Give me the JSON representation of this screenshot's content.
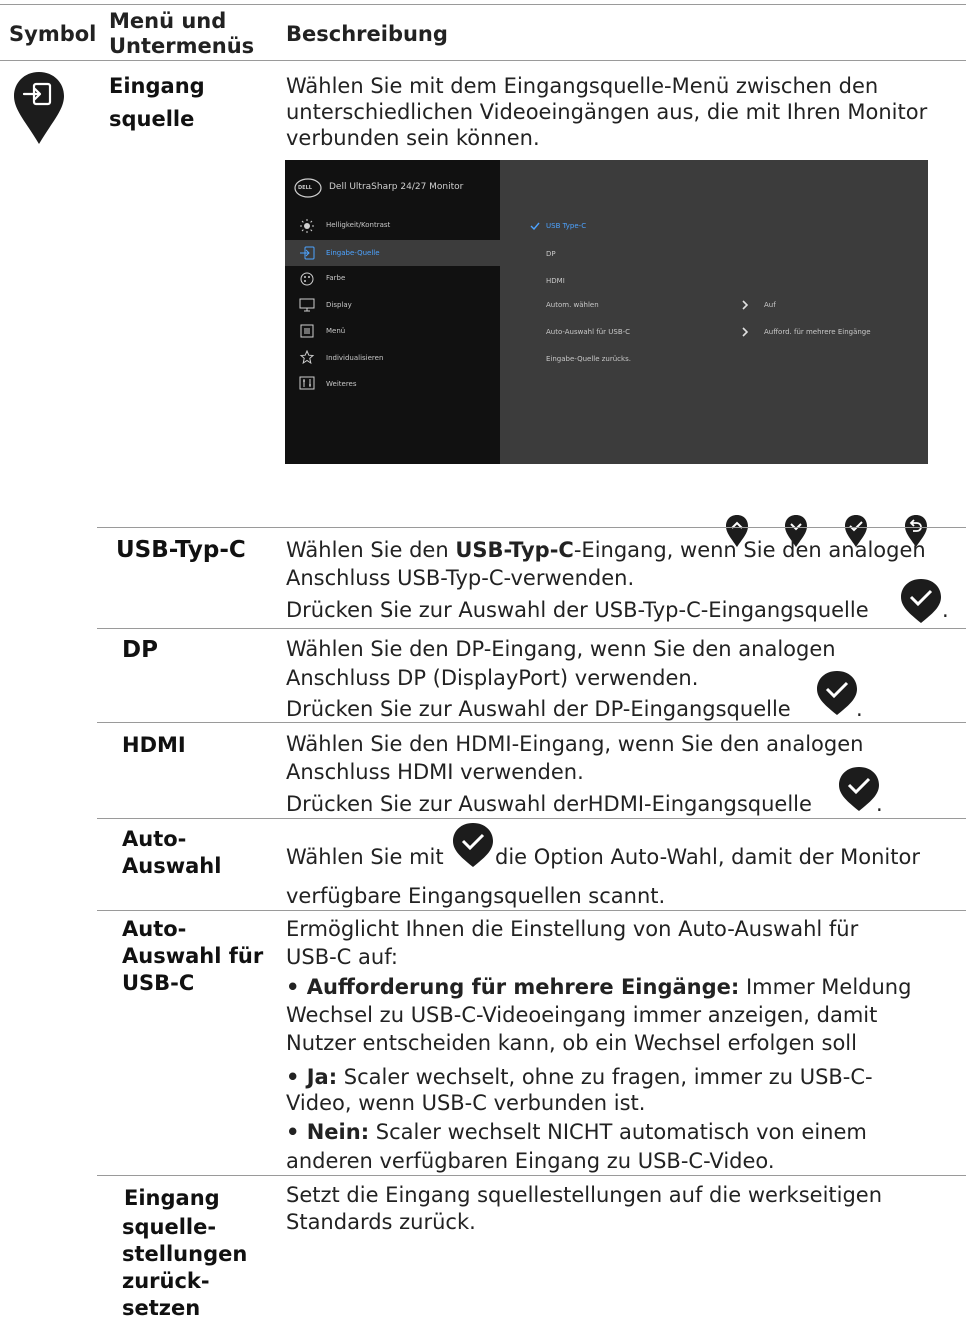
{
  "header": {
    "symbol": "Symbol",
    "menu_line1": "Menü und",
    "menu_line2": "Untermenüs",
    "description": "Beschreibung"
  },
  "input_source": {
    "label_line1": "Eingang",
    "label_line2": "squelle",
    "desc_lines": [
      "Wählen Sie mit dem Eingangsquelle-Menü zwischen den",
      "unterschiedlichen Videoeingängen aus, die mit Ihren Monitor",
      "verbunden sein können."
    ],
    "icon": "input-source-pin-icon"
  },
  "osd": {
    "brand": "DELL",
    "title": "Dell UltraSharp 24/27 Monitor",
    "menu": [
      {
        "label": "Helligkeit/Kontrast",
        "icon": "brightness-icon"
      },
      {
        "label": "Eingabe-Quelle",
        "icon": "input-icon",
        "selected": true
      },
      {
        "label": "Farbe",
        "icon": "color-icon"
      },
      {
        "label": "Display",
        "icon": "display-icon"
      },
      {
        "label": "Menü",
        "icon": "menu-icon"
      },
      {
        "label": "Individualisieren",
        "icon": "star-icon"
      },
      {
        "label": "Weiteres",
        "icon": "others-icon"
      }
    ],
    "options": [
      {
        "label": "USB Type-C",
        "checked": true
      },
      {
        "label": "DP"
      },
      {
        "label": "HDMI"
      },
      {
        "label": "Autom. wählen",
        "value": "Auf"
      },
      {
        "label": "Auto-Auswahl für USB-C",
        "value": "Aufford. für mehrere Eingänge"
      },
      {
        "label": "Eingabe-Quelle zurücks."
      }
    ],
    "colors": {
      "left": "#111111",
      "right": "#3c3c3c",
      "accent": "#4da3ff"
    }
  },
  "nav_buttons": [
    "up-pin-icon",
    "down-pin-icon",
    "check-pin-icon",
    "back-pin-icon"
  ],
  "rows": {
    "usbc": {
      "label": "USB-Typ-C",
      "l1_pre": "Wählen Sie den ",
      "l1_bold": "USB-Typ-C",
      "l1_post": "-Eingang, wenn Sie den analogen",
      "l2": "Anschluss USB-Typ-C-verwenden.",
      "l3": "Drücken Sie zur Auswahl der USB-Typ-C-Eingangsquelle",
      "l3_end": "."
    },
    "dp": {
      "label": "DP",
      "l1": "Wählen Sie den DP-Eingang, wenn Sie den analogen",
      "l2": "Anschluss DP (DisplayPort) verwenden.",
      "l3": "Drücken Sie zur Auswahl der DP-Eingangsquelle",
      "l3_end": "."
    },
    "hdmi": {
      "label": "HDMI",
      "l1": "Wählen Sie den HDMI-Eingang, wenn Sie den analogen",
      "l2": "Anschluss HDMI verwenden.",
      "l3": "Drücken Sie zur Auswahl derHDMI-Eingangsquelle",
      "l3_end": "."
    },
    "auto": {
      "label_line1": "Auto-",
      "label_line2": "Auswahl",
      "l1_pre": "Wählen Sie mit",
      "l1_post": "die Option Auto-Wahl, damit der Monitor",
      "l2": "verfügbare Eingangsquellen scannt."
    },
    "auto_usbc": {
      "label_lines": [
        "Auto-",
        "Auswahl für",
        "USB-C"
      ],
      "l1": "Ermöglicht Ihnen die Einstellung von Auto-Auswahl für",
      "l2": "USB-C auf:",
      "b1_bold": "• Aufforderung für mehrere Eingänge:",
      "b1_rest": " Immer Meldung",
      "b1_l2": "Wechsel zu USB-C-Videoeingang immer anzeigen, damit",
      "b1_l3": "Nutzer entscheiden kann, ob ein Wechsel erfolgen soll",
      "b2_bold": "• Ja:",
      "b2_rest": " Scaler wechselt, ohne zu fragen, immer zu USB-C-",
      "b2_l2": "Video, wenn USB-C verbunden ist.",
      "b3_bold": "• Nein:",
      "b3_rest": " Scaler wechselt NICHT automatisch von einem",
      "b3_l2": "anderen verfügbaren Eingang zu USB-C-Video."
    },
    "reset": {
      "label_lines": [
        "Eingang",
        "squelle-",
        "stellungen",
        "zurück-",
        "setzen"
      ],
      "l1": "Setzt die Eingang squellestellungen auf die werkseitigen",
      "l2": "Standards zurück."
    }
  }
}
